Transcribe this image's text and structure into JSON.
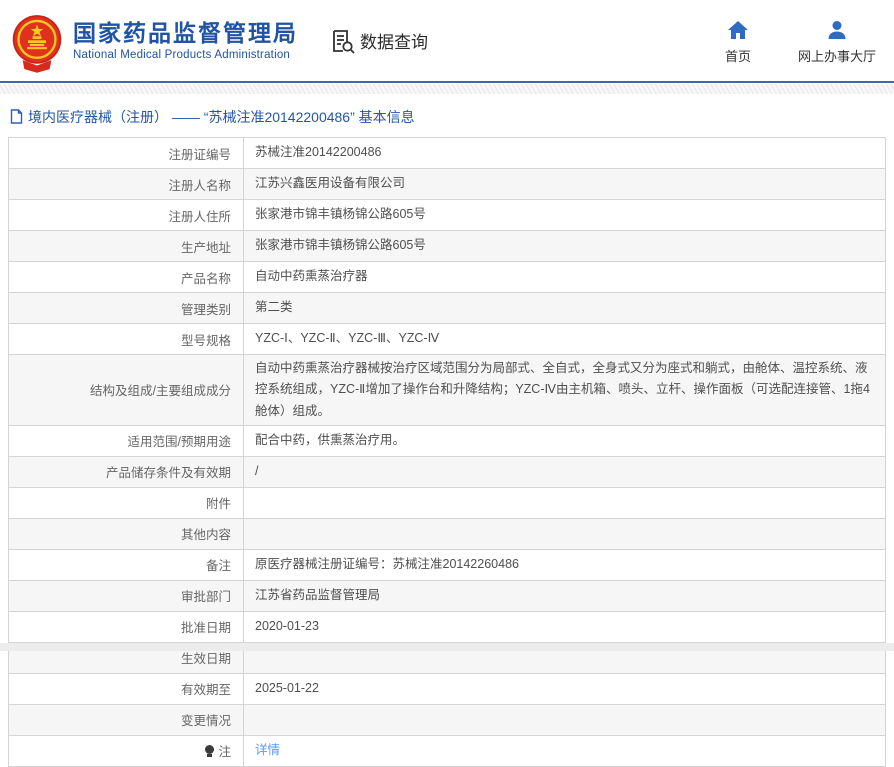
{
  "header": {
    "org_name_cn": "国家药品监督管理局",
    "org_name_en": "National Medical Products Administration",
    "section_label": "数据查询",
    "nav": {
      "home_label": "首页",
      "hall_label": "网上办事大厅"
    }
  },
  "breadcrumb": {
    "text": "境内医疗器械（注册） —— “苏械注准20142200486” 基本信息"
  },
  "table": {
    "rows": [
      {
        "label": "注册证编号",
        "value": "苏械注准20142200486"
      },
      {
        "label": "注册人名称",
        "value": "江苏兴鑫医用设备有限公司"
      },
      {
        "label": "注册人住所",
        "value": "张家港市锦丰镇杨锦公路605号"
      },
      {
        "label": "生产地址",
        "value": "张家港市锦丰镇杨锦公路605号"
      },
      {
        "label": "产品名称",
        "value": "自动中药熏蒸治疗器"
      },
      {
        "label": "管理类别",
        "value": "第二类"
      },
      {
        "label": "型号规格",
        "value": "YZC-Ⅰ、YZC-Ⅱ、YZC-Ⅲ、YZC-Ⅳ"
      },
      {
        "label": "结构及组成/主要组成成分",
        "value": "自动中药熏蒸治疗器械按治疗区域范围分为局部式、全自式，全身式又分为座式和躺式，由舱体、温控系统、液控系统组成，YZC-Ⅱ增加了操作台和升降结构；YZC-Ⅳ由主机箱、喷头、立杆、操作面板（可选配连接管、1拖4舱体）组成。"
      },
      {
        "label": "适用范围/预期用途",
        "value": "配合中药，供熏蒸治疗用。"
      },
      {
        "label": "产品储存条件及有效期",
        "value": "/"
      },
      {
        "label": "附件",
        "value": ""
      },
      {
        "label": "其他内容",
        "value": ""
      },
      {
        "label": "备注",
        "value": "原医疗器械注册证编号：苏械注准20142260486"
      },
      {
        "label": "审批部门",
        "value": "江苏省药品监督管理局"
      },
      {
        "label": "批准日期",
        "value": "2020-01-23"
      },
      {
        "label": "生效日期",
        "value": ""
      },
      {
        "label": "有效期至",
        "value": "2025-01-22"
      },
      {
        "label": "变更情况",
        "value": ""
      },
      {
        "label": "注",
        "value": "详情",
        "link": true,
        "label_icon": "bulb-icon"
      }
    ]
  },
  "colors": {
    "brand_blue": "#2053a4",
    "header_border_blue": "#3a69b0",
    "nav_icon_blue": "#2f6cc1",
    "link_blue": "#569af5",
    "row_alt_gray": "#f6f6f6",
    "table_border": "#d4d4d4"
  }
}
